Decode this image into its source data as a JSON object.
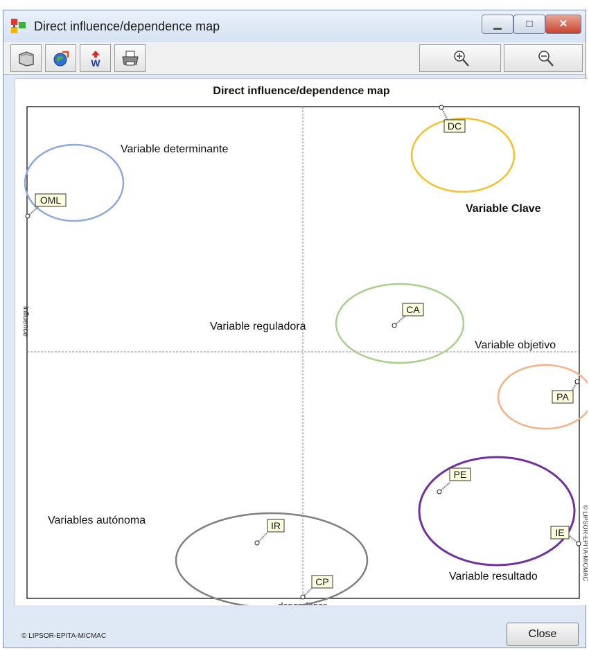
{
  "window": {
    "title": "Direct influence/dependence map",
    "controls": {
      "minimize": "▁",
      "maximize": "□",
      "close": "✕"
    }
  },
  "toolbar": {
    "buttons": [
      "copy-icon",
      "export-icon",
      "word-export-icon",
      "print-icon"
    ],
    "zoom_in": "zoom-in-icon",
    "zoom_out": "zoom-out-icon"
  },
  "map": {
    "title": "Direct influence/dependence map",
    "x_axis_label": "dependence",
    "y_axis_label": "influence",
    "side_credit": "© LIPSOR-EPITA-MICMAC",
    "quadrant_labels": {
      "determinante": "Variable determinante",
      "clave": "Variable Clave",
      "reguladora": "Variable reguladora",
      "objetivo": "Variable objetivo",
      "autonoma": "Variables autónoma",
      "resultado": "Variable resultado"
    },
    "cluster_colors": {
      "determinante": "#8ea9db",
      "clave": "#f5c02a",
      "reguladora": "#a8d08d",
      "objetivo": "#f4b183",
      "autonoma": "#7f7f7f",
      "resultado": "#7030a0"
    },
    "variables": [
      "OML",
      "DC",
      "CA",
      "PA",
      "PE",
      "IE",
      "IR",
      "CP"
    ]
  },
  "footer": {
    "copyright": "© LIPSOR-EPITA-MICMAC",
    "close_label": "Close"
  }
}
